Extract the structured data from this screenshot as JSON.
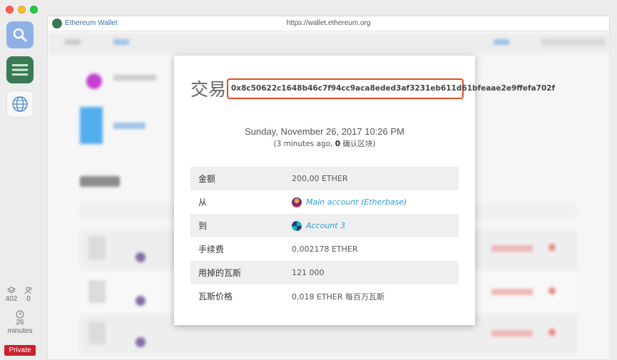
{
  "browser": {
    "site_name": "Ethereum Wallet",
    "url": "https://wallet.ethereum.org"
  },
  "sidebar": {
    "peers_count": "402",
    "blocks_count": "0",
    "time_value": "26",
    "time_unit": "minutes",
    "private_label": "Private"
  },
  "modal": {
    "title": "交易",
    "tx_hash": "0x8c50622c1648b46c7f94cc9aca8eded3af3231eb611d61bfeaae2e9ffefa702f",
    "date": "Sunday, November 26, 2017 10:26 PM",
    "ago": "(3 minutes ago,",
    "confirm_count": "0",
    "confirm_label": "确认区块)",
    "rows": [
      {
        "label": "金额",
        "value": "200,00 ETHER"
      },
      {
        "label": "从",
        "value": "Main account (Etherbase)"
      },
      {
        "label": "到",
        "value": "Account 3"
      },
      {
        "label": "手续费",
        "value": "0,002178 ETHER"
      },
      {
        "label": "用掉的瓦斯",
        "value": "121 000"
      },
      {
        "label": "瓦斯价格",
        "value": "0,018 ETHER 每百万瓦斯"
      }
    ]
  },
  "icons": {
    "dock": [
      "search-icon",
      "wallet-icon",
      "globe-icon"
    ],
    "stats": [
      "layers-icon",
      "peers-icon",
      "clock-icon"
    ]
  }
}
